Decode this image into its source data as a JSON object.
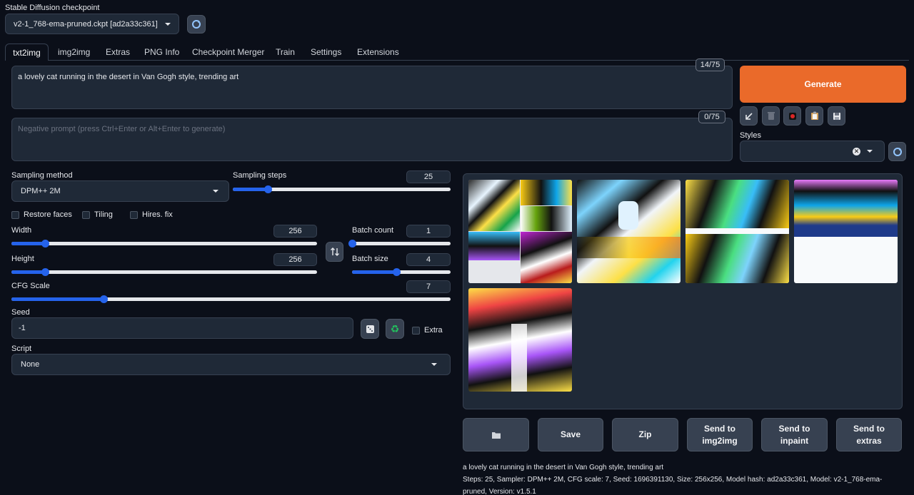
{
  "checkpoint": {
    "label": "Stable Diffusion checkpoint",
    "value": "v2-1_768-ema-pruned.ckpt [ad2a33c361]"
  },
  "tabs": [
    "txt2img",
    "img2img",
    "Extras",
    "PNG Info",
    "Checkpoint Merger",
    "Train",
    "Settings",
    "Extensions"
  ],
  "prompt": {
    "value": "a lovely cat running in the desert in Van Gogh style, trending art",
    "counter": "14/75"
  },
  "negative": {
    "placeholder": "Negative prompt (press Ctrl+Enter or Alt+Enter to generate)",
    "counter": "0/75"
  },
  "generate_label": "Generate",
  "styles_label": "Styles",
  "sampling": {
    "method_label": "Sampling method",
    "method_value": "DPM++ 2M",
    "steps_label": "Sampling steps",
    "steps_value": "25",
    "steps_frac": 0.16
  },
  "checks": {
    "restore_faces": "Restore faces",
    "tiling": "Tiling",
    "hires_fix": "Hires. fix",
    "extra": "Extra"
  },
  "width": {
    "label": "Width",
    "value": "256",
    "frac": 0.11
  },
  "height": {
    "label": "Height",
    "value": "256",
    "frac": 0.11
  },
  "batch_count": {
    "label": "Batch count",
    "value": "1",
    "frac": 0.0
  },
  "batch_size": {
    "label": "Batch size",
    "value": "4",
    "frac": 0.45
  },
  "cfg": {
    "label": "CFG Scale",
    "value": "7",
    "frac": 0.21
  },
  "seed": {
    "label": "Seed",
    "value": "-1"
  },
  "script": {
    "label": "Script",
    "value": "None"
  },
  "buttons": {
    "save": "Save",
    "zip": "Zip",
    "send_img2img": "Send to img2img",
    "send_inpaint": "Send to inpaint",
    "send_extras": "Send to extras"
  },
  "info": {
    "prompt": "a lovely cat running in the desert in Van Gogh style, trending art",
    "params": "Steps: 25, Sampler: DPM++ 2M, CFG scale: 7, Seed: 1696391130, Size: 256x256, Model hash: ad2a33c361, Model: v2-1_768-ema-pruned, Version: v1.5.1"
  },
  "colors": {
    "accent": "#2563eb",
    "generate": "#ea6a2a",
    "background": "#0b0f19"
  }
}
